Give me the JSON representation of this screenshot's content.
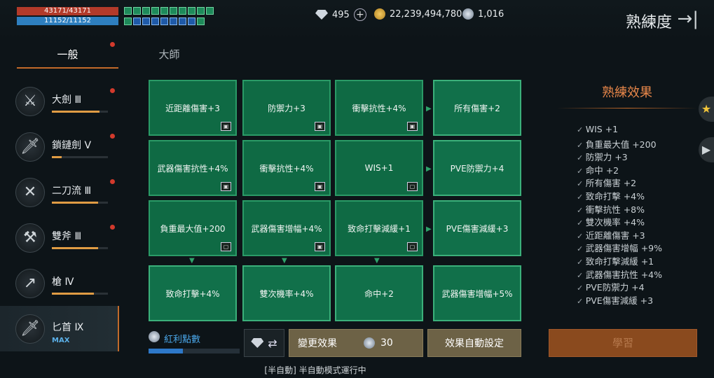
{
  "hud": {
    "hp": "43171/43171",
    "mp": "11152/11152"
  },
  "currency": {
    "diamonds": "495",
    "gold": "22,239,494,780",
    "orbs": "1,016"
  },
  "page_title": "熟練度",
  "tabs": [
    {
      "label": "一般"
    },
    {
      "label": "大師"
    }
  ],
  "weapons": [
    {
      "name": "大劍 Ⅲ",
      "progress": 0.85
    },
    {
      "name": "鎖鏈劍 Ⅴ",
      "progress": 0.18
    },
    {
      "name": "二刀流 Ⅲ",
      "progress": 0.83
    },
    {
      "name": "雙斧 Ⅲ",
      "progress": 0.83
    },
    {
      "name": "槍 Ⅳ",
      "progress": 0.75
    },
    {
      "name": "匕首 Ⅸ",
      "badge": "MAX"
    }
  ],
  "grid": [
    [
      "近距離傷害+3",
      "防禦力+3",
      "衝擊抗性+4%",
      "所有傷害+2"
    ],
    [
      "武器傷害抗性+4%",
      "衝擊抗性+4%",
      "WIS+1",
      "PVE防禦力+4"
    ],
    [
      "負重最大值+200",
      "武器傷害增幅+4%",
      "致命打擊減緩+1",
      "PVE傷害減緩+3"
    ],
    [
      "致命打擊+4%",
      "雙次機率+4%",
      "命中+2",
      "武器傷害增幅+5%"
    ]
  ],
  "effects": {
    "title": "熟練效果",
    "items": [
      "WIS +1",
      "負重最大值 +200",
      "防禦力 +3",
      "命中 +2",
      "所有傷害 +2",
      "致命打擊 +4%",
      "衝擊抗性 +8%",
      "雙次機率 +4%",
      "近距離傷害 +3",
      "武器傷害增幅 +9%",
      "致命打擊減緩 +1",
      "武器傷害抗性 +4%",
      "PVE防禦力 +4",
      "PVE傷害減緩 +3"
    ]
  },
  "bonus": {
    "label": "紅利點數",
    "progress": 0.38
  },
  "buttons": {
    "change": "變更效果",
    "change_cost": "30",
    "auto": "效果自動設定",
    "learn": "學習"
  },
  "status": "[半自動] 半自動模式運行中"
}
